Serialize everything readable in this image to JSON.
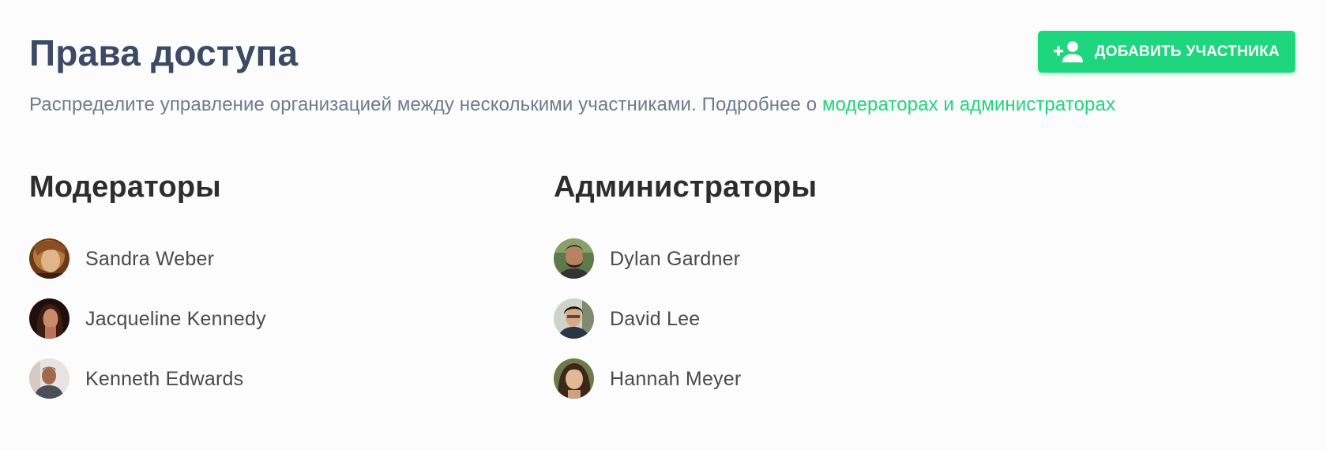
{
  "header": {
    "title": "Права доступа",
    "add_button_label": "ДОБАВИТЬ УЧАСТНИКА",
    "add_button_icon": "person-add-icon",
    "subtitle_text": "Распределите управление организацией между несколькими участниками. Подробнее о ",
    "subtitle_link": "модераторах и администраторах"
  },
  "colors": {
    "accent": "#1ed67d",
    "title": "#3d4a63",
    "subtitle": "#6f7a8c",
    "name": "#4a4a4a"
  },
  "moderators": {
    "title": "Модераторы",
    "members": [
      {
        "name": "Sandra Weber"
      },
      {
        "name": "Jacqueline Kennedy"
      },
      {
        "name": "Kenneth Edwards"
      }
    ]
  },
  "admins": {
    "title": "Администраторы",
    "members": [
      {
        "name": "Dylan Gardner"
      },
      {
        "name": "David Lee"
      },
      {
        "name": "Hannah Meyer"
      }
    ]
  }
}
